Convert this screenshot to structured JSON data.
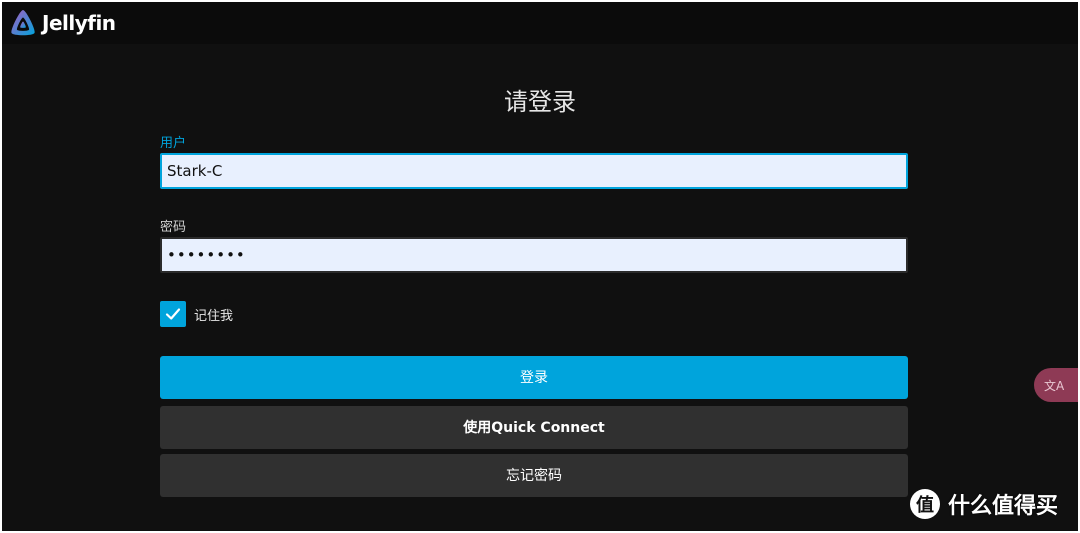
{
  "header": {
    "app_name": "Jellyfin"
  },
  "login": {
    "title": "请登录",
    "username_label": "用户",
    "username_value": "Stark-C",
    "password_label": "密码",
    "password_value": "••••••••",
    "remember_label": "记住我",
    "remember_checked": true,
    "login_button": "登录",
    "quick_connect_button": "使用Quick Connect",
    "forgot_password_button": "忘记密码"
  },
  "translate_fab": {
    "label": "文A"
  },
  "watermark": {
    "logo_char": "值",
    "text": "什么值得买"
  },
  "colors": {
    "accent": "#00a4dc",
    "background": "#101010",
    "header": "#0b0b0b",
    "secondary_button": "#303030",
    "input_bg": "#e8f0fe"
  }
}
